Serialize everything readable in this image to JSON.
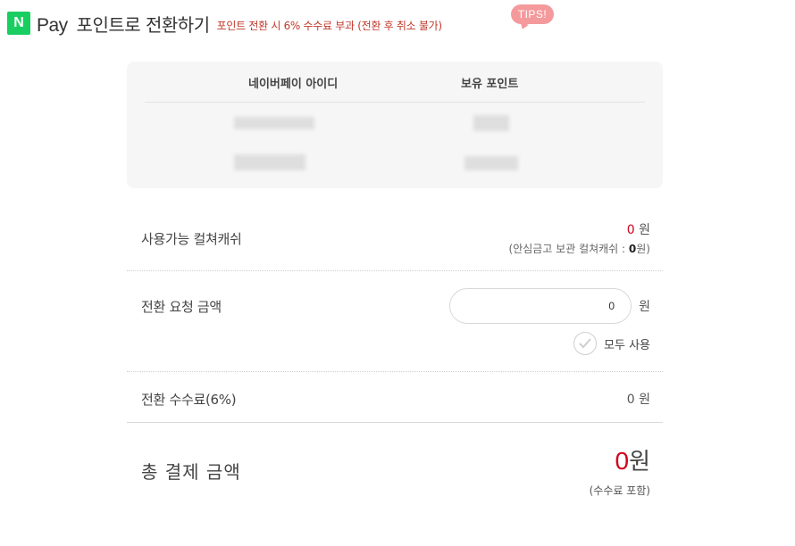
{
  "header": {
    "logo": "N",
    "title_pay": "Pay",
    "title_rest": "포인트로 전환하기",
    "notice": "포인트 전환 시 6% 수수료 부과 (전환 후 취소 불가)",
    "tips": "TIPS!"
  },
  "account_table": {
    "headers": [
      "네이버페이 아이디",
      "보유 포인트"
    ],
    "rows_masked": true
  },
  "available": {
    "label": "사용가능 컬쳐캐쉬",
    "value": "0",
    "unit": "원",
    "sub_prefix": "(안심금고 보관 컬쳐캐쉬 : ",
    "sub_value": "0",
    "sub_suffix": "원)"
  },
  "request": {
    "label": "전환 요청 금액",
    "input_value": "0",
    "unit": "원",
    "use_all_label": "모두 사용"
  },
  "fee": {
    "label": "전환 수수료(6%)",
    "value": "0 원"
  },
  "total": {
    "label": "총 결제 금액",
    "value": "0",
    "unit": "원",
    "note": "(수수료 포함)"
  },
  "colors": {
    "brand_green": "#19ce60",
    "accent_red": "#d0021b",
    "tips_pink": "#f49a9c"
  }
}
